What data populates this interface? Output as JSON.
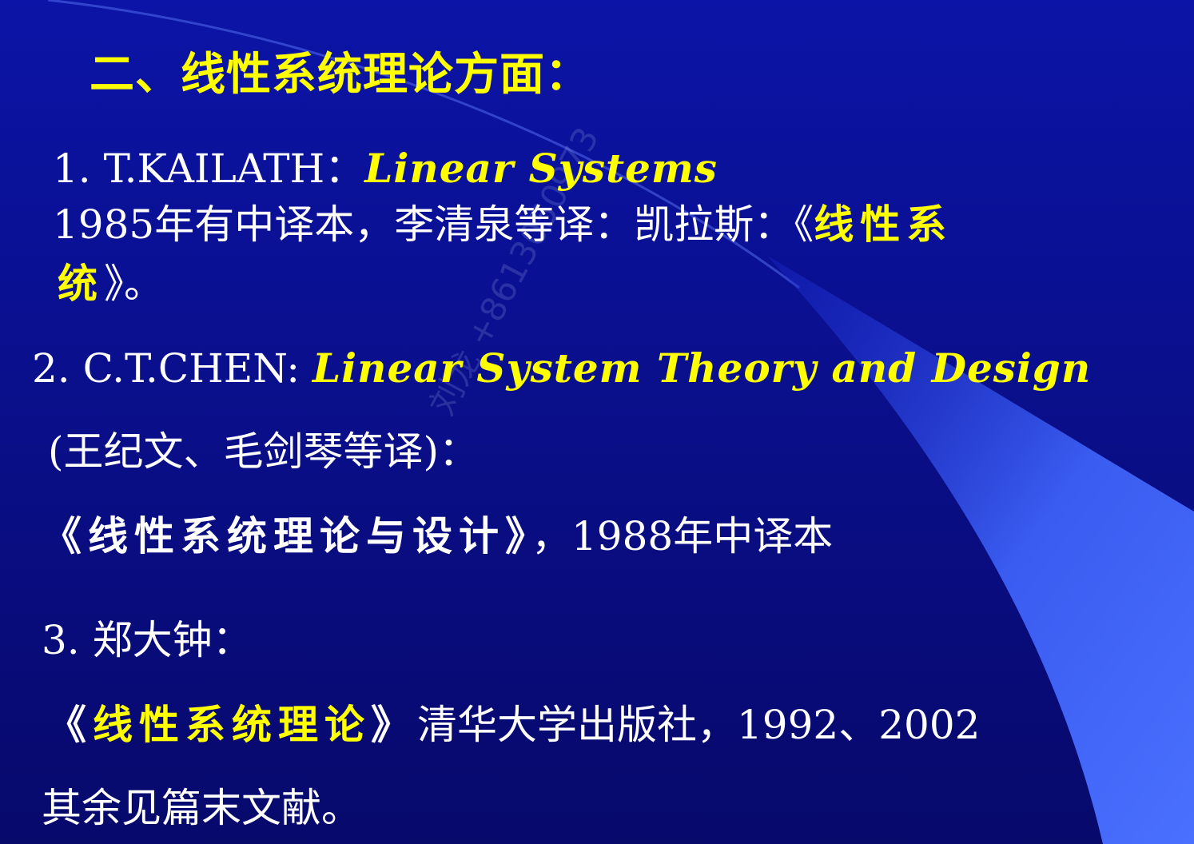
{
  "title": "二、线性系统理论方面：",
  "watermark": "刘龙 +8613050973",
  "ref1": {
    "number": "1. T.KAILATH：",
    "book_en": "Linear  Systems",
    "translation_prefix": "1985年有中译本，李清泉等译：凯拉斯：《",
    "book_cn_part1": "线性系",
    "book_cn_part2": "统",
    "translation_suffix": "》。"
  },
  "ref2": {
    "number": "2. C.T.CHEN:",
    "book_en": "Linear  System  Theory  and  Design",
    "translators": "(王纪文、毛剑琴等译)：",
    "book_cn": "《线性系统理论与设计》",
    "year_note": "，1988年中译本"
  },
  "ref3": {
    "number": "3. 郑大钟：",
    "open_bracket": "《",
    "book_cn": "线性系统理论",
    "close_bracket": "》",
    "publisher": "清华大学出版社，1992、2002"
  },
  "footer": "其余见篇末文献。",
  "colors": {
    "background": "#0a0f8c",
    "accent_text": "#ffff00",
    "body_text": "#ffffff",
    "swoosh": "#3a5cf0"
  }
}
